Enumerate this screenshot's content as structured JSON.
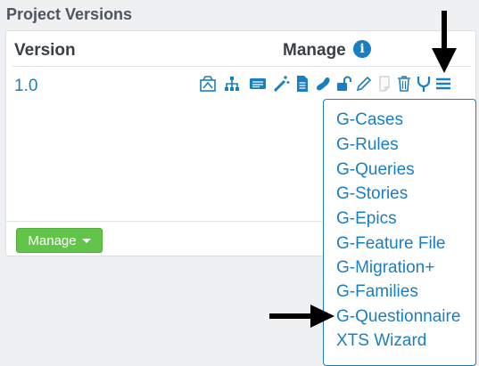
{
  "section": {
    "title": "Project Versions"
  },
  "table": {
    "headers": {
      "version": "Version",
      "manage": "Manage"
    },
    "rows": [
      {
        "version": "1.0"
      }
    ]
  },
  "icons": [
    "dashboard-icon",
    "hierarchy-icon",
    "list-card-icon",
    "magic-wand-icon",
    "document-icon",
    "bean-icon",
    "unlock-icon",
    "pencil-icon",
    "blank-page-icon",
    "trash-icon",
    "fork-icon",
    "hamburger-menu-icon"
  ],
  "footer": {
    "manage_button": "Manage"
  },
  "dropdown": {
    "items": [
      "G-Cases",
      "G-Rules",
      "G-Queries",
      "G-Stories",
      "G-Epics",
      "G-Feature File",
      "G-Migration+",
      "G-Families",
      "G-Questionnaire",
      "XTS Wizard"
    ]
  },
  "colors": {
    "link": "#1a7fc1",
    "button": "#62c449",
    "text": "#3a3f45"
  }
}
